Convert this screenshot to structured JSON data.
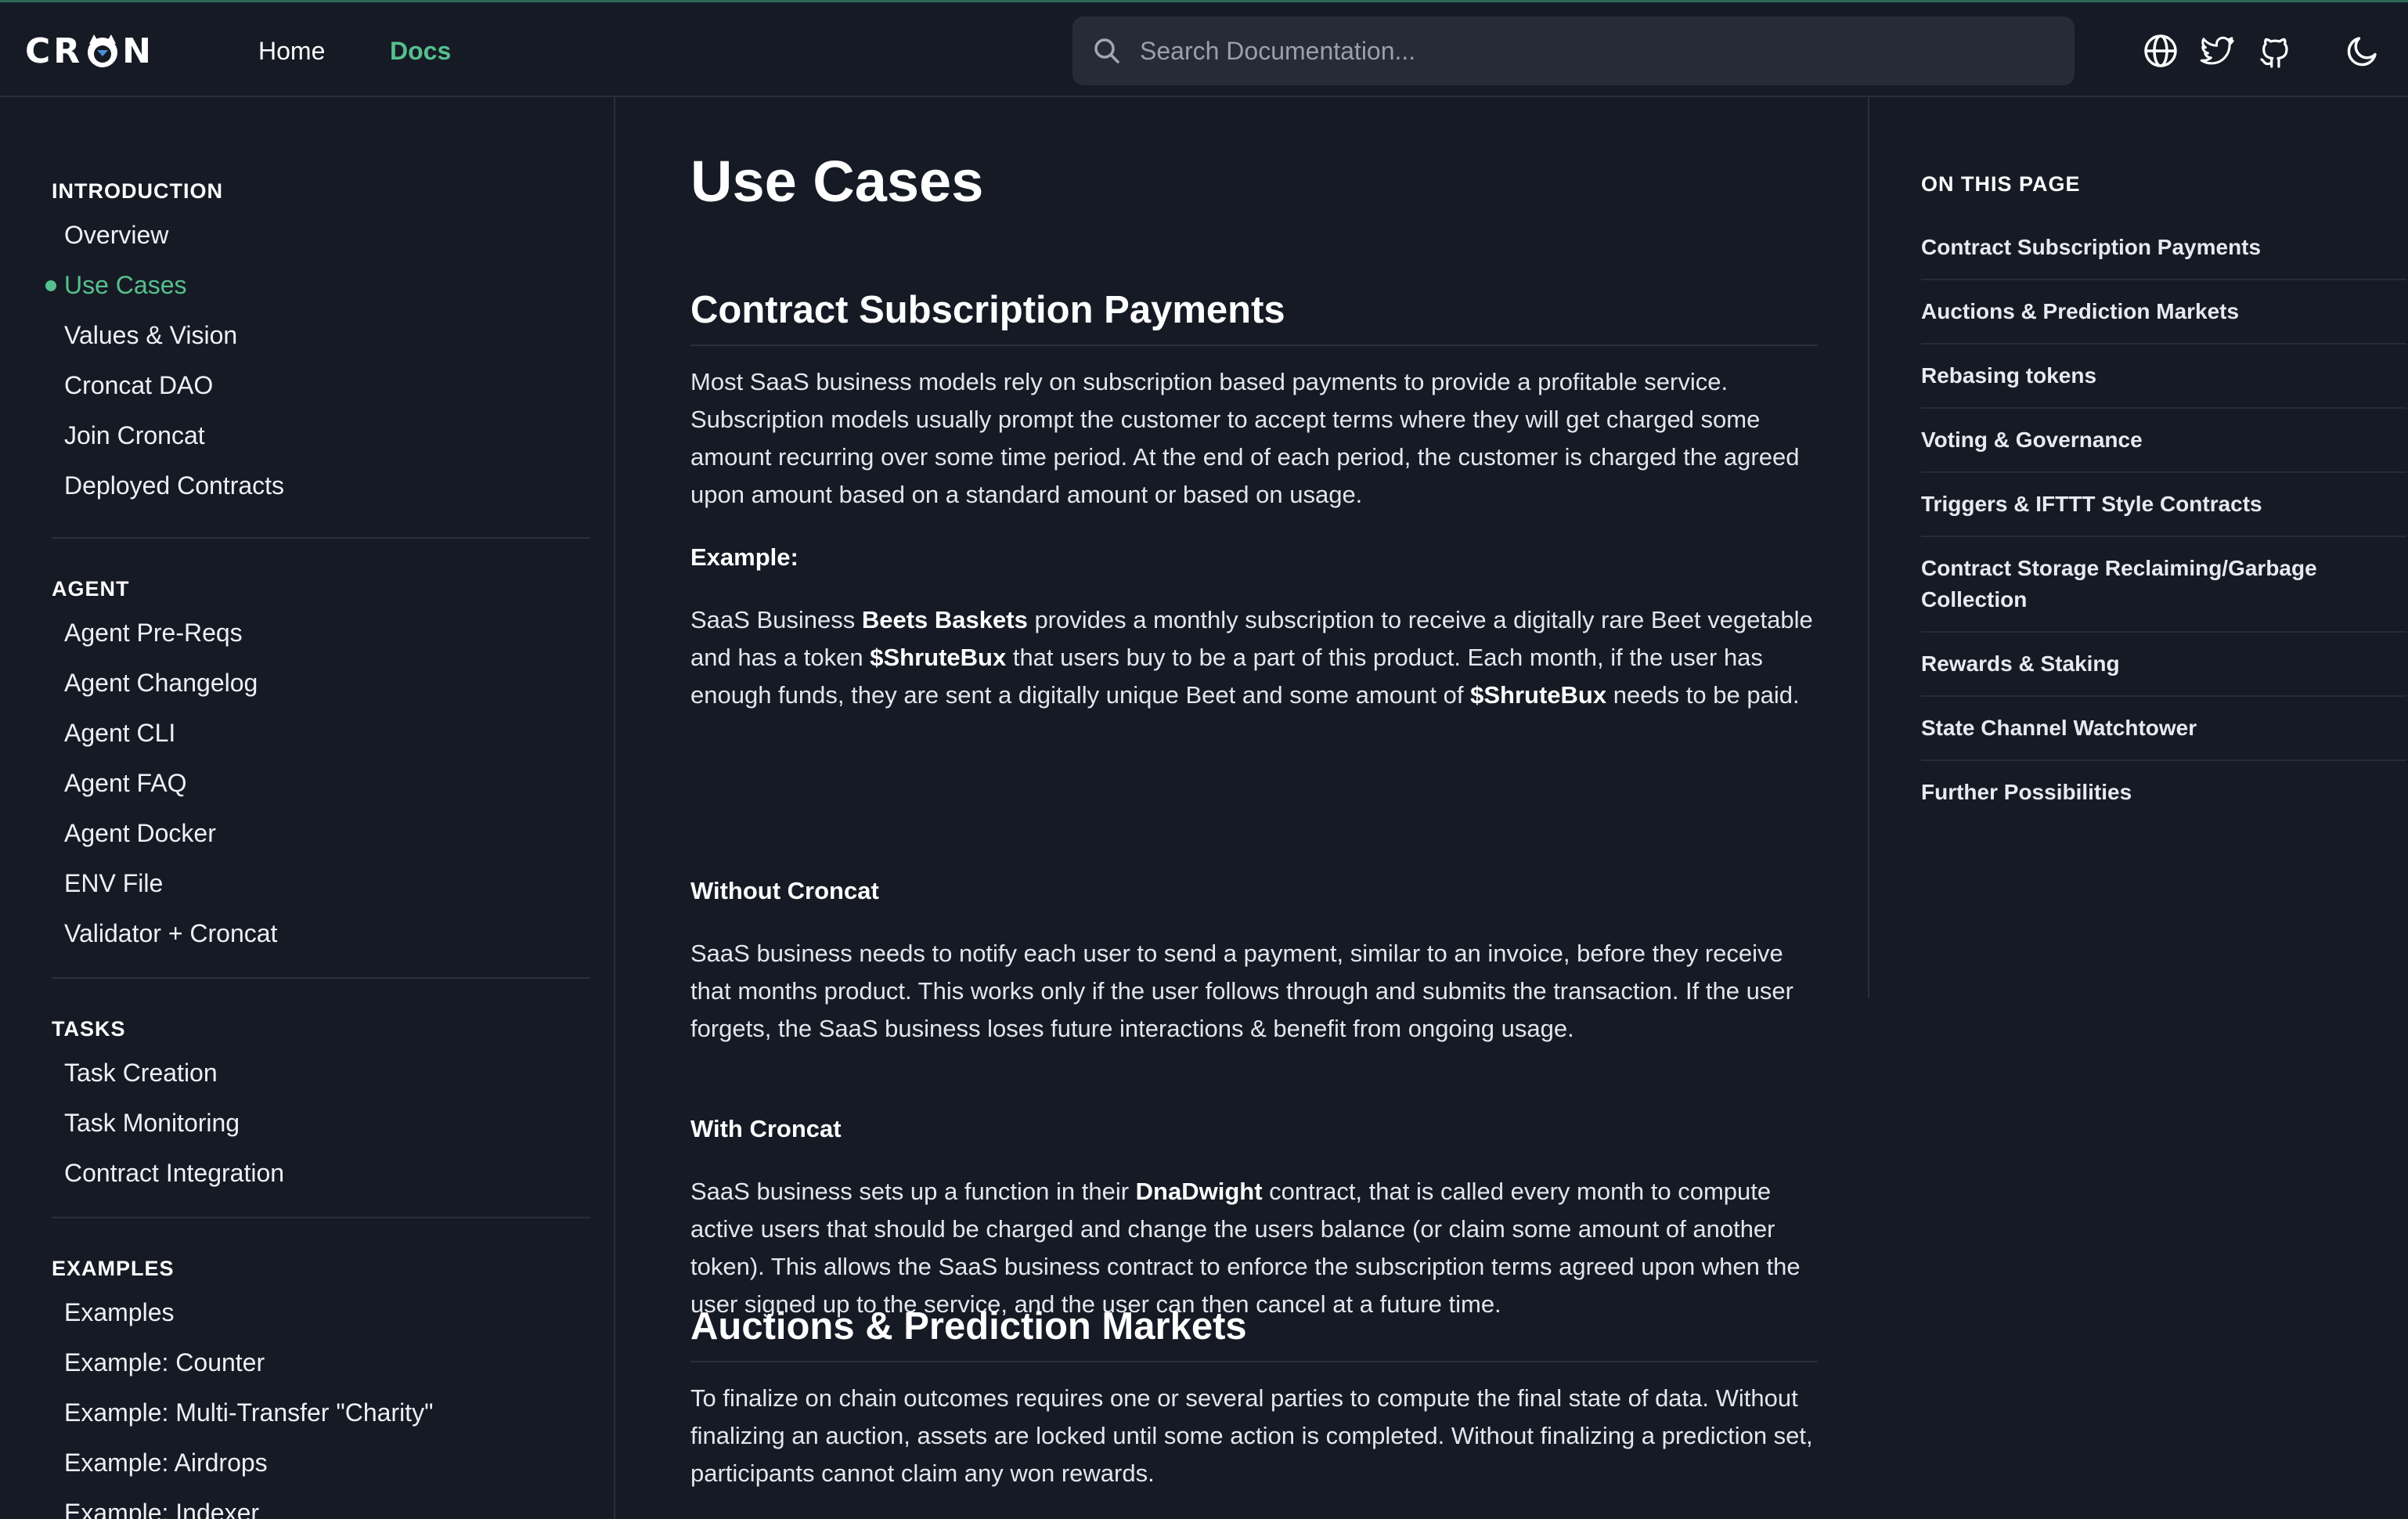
{
  "header": {
    "logo_left": "CR",
    "logo_right": "N",
    "nav": [
      {
        "label": "Home"
      },
      {
        "label": "Docs"
      }
    ],
    "search_placeholder": "Search Documentation...",
    "icons": [
      "globe-icon",
      "twitter-icon",
      "github-icon",
      "moon-icon"
    ],
    "accent": "#55c08d"
  },
  "sidebar": {
    "sections": [
      {
        "heading": "INTRODUCTION",
        "items": [
          "Overview",
          "Use Cases",
          "Values & Vision",
          "Croncat DAO",
          "Join Croncat",
          "Deployed Contracts"
        ],
        "active": "Use Cases"
      },
      {
        "heading": "AGENT",
        "items": [
          "Agent Pre-Reqs",
          "Agent Changelog",
          "Agent CLI",
          "Agent FAQ",
          "Agent Docker",
          "ENV File",
          "Validator + Croncat"
        ]
      },
      {
        "heading": "TASKS",
        "items": [
          "Task Creation",
          "Task Monitoring",
          "Contract Integration"
        ]
      },
      {
        "heading": "EXAMPLES",
        "items": [
          "Examples",
          "Example: Counter",
          "Example: Multi-Transfer \"Charity\"",
          "Example: Airdrops",
          "Example: Indexer"
        ]
      }
    ]
  },
  "main": {
    "title": "Use Cases",
    "s1": {
      "heading": "Contract Subscription Payments",
      "p1": "Most SaaS business models rely on subscription based payments to provide a profitable service. Subscription models usually prompt the customer to accept terms where they will get charged some amount recurring over some time period. At the end of each period, the customer is charged the agreed upon amount based on a standard amount or based on usage.",
      "example_label": "Example:",
      "ex_a": "SaaS Business ",
      "ex_b": "Beets Baskets",
      "ex_c": " provides a monthly subscription to receive a digitally rare Beet vegetable and has a token ",
      "ex_d": "$ShruteBux",
      "ex_e": " that users buy to be a part of this product. Each month, if the user has enough funds, they are sent a digitally unique Beet and some amount of ",
      "ex_f": "$ShruteBux",
      "ex_g": " needs to be paid.",
      "without_label": "Without Croncat",
      "without_text": "SaaS business needs to notify each user to send a payment, similar to an invoice, before they receive that months product. This works only if the user follows through and submits the transaction. If the user forgets, the SaaS business loses future interactions & benefit from ongoing usage.",
      "with_label": "With Croncat",
      "with_a": "SaaS business sets up a function in their ",
      "with_b": "DnaDwight",
      "with_c": " contract, that is called every month to compute active users that should be charged and change the users balance (or claim some amount of another token). This allows the SaaS business contract to enforce the subscription terms agreed upon when the user signed up to the service, and the user can then cancel at a future time."
    },
    "s2": {
      "heading": "Auctions & Prediction Markets",
      "p1": "To finalize on chain outcomes requires one or several parties to compute the final state of data. Without finalizing an auction, assets are locked until some action is completed. Without finalizing a prediction set, participants cannot claim any won rewards."
    }
  },
  "toc": {
    "heading": "ON THIS PAGE",
    "items": [
      "Contract Subscription Payments",
      "Auctions & Prediction Markets",
      "Rebasing tokens",
      "Voting & Governance",
      "Triggers & IFTTT Style Contracts",
      "Contract Storage Reclaiming/Garbage Collection",
      "Rewards & Staking",
      "State Channel Watchtower",
      "Further Possibilities"
    ]
  }
}
